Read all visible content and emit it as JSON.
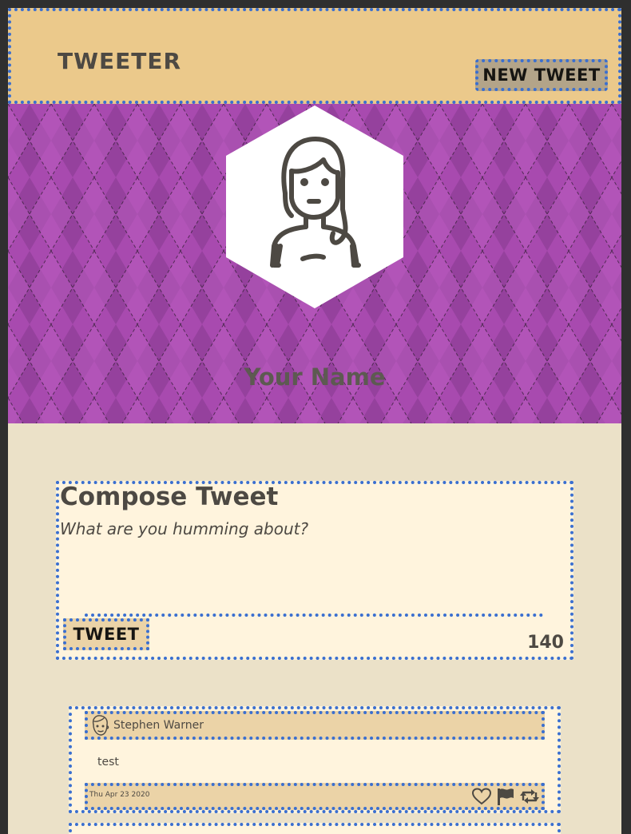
{
  "header": {
    "brand": "Tweeter",
    "new_tweet_label": "New Tweet"
  },
  "profile": {
    "name": "Your Name",
    "avatar_icon": "woman-avatar-icon"
  },
  "compose": {
    "title": "Compose Tweet",
    "placeholder": "What are you humming about?",
    "value": "",
    "submit_label": "Tweet",
    "counter": "140"
  },
  "tweets": [
    {
      "author": "Stephen Warner",
      "avatar_icon": "man-avatar-icon",
      "content": "test",
      "date": "Thu Apr 23 2020",
      "actions": [
        "heart-icon",
        "flag-icon",
        "retweet-icon"
      ]
    }
  ],
  "colors": {
    "header_bg": "#ebc98b",
    "banner_purple": "#a344ad",
    "page_bg": "#ebe1c8",
    "card_bg": "#fff4dd",
    "text": "#4d4943"
  }
}
